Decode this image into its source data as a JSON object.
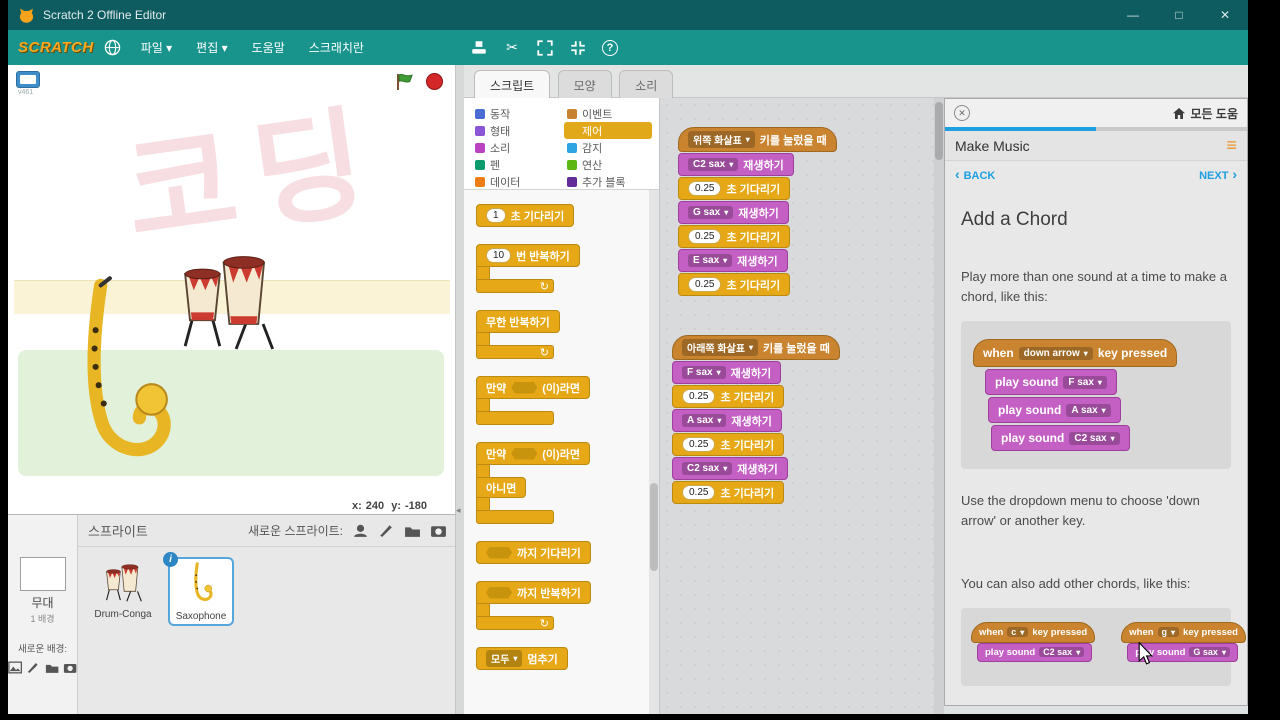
{
  "window": {
    "title": "Scratch 2 Offline Editor",
    "controls": {
      "minimize": "—",
      "maximize": "□",
      "close": "✕"
    }
  },
  "menubar": {
    "logo": "SCRATCH",
    "items": [
      {
        "label": "파일 ▾"
      },
      {
        "label": "편집 ▾"
      },
      {
        "label": "도움말"
      },
      {
        "label": "스크래치란"
      }
    ]
  },
  "stage": {
    "version": "v461",
    "watermark": "코딩",
    "coords": {
      "x_label": "x:",
      "x_value": "240",
      "y_label": "y:",
      "y_value": "-180"
    }
  },
  "sprites_panel": {
    "title": "스프라이트",
    "new_sprite_label": "새로운 스프라이트:",
    "stage_section": {
      "label": "무대",
      "count": "1 배경",
      "new_backdrop_label": "새로운 배경:"
    },
    "items": [
      {
        "name": "Drum-Conga"
      },
      {
        "name": "Saxophone"
      }
    ]
  },
  "script_area": {
    "tabs": [
      {
        "label": "스크립트"
      },
      {
        "label": "모양"
      },
      {
        "label": "소리"
      }
    ],
    "categories": {
      "col1": [
        {
          "label": "동작",
          "color": "#4a6cd4"
        },
        {
          "label": "형태",
          "color": "#8a55d7"
        },
        {
          "label": "소리",
          "color": "#bb42c3"
        },
        {
          "label": "펜",
          "color": "#0e9a6c"
        },
        {
          "label": "데이터",
          "color": "#ee7d16"
        }
      ],
      "col2": [
        {
          "label": "이벤트",
          "color": "#c88330"
        },
        {
          "label": "제어",
          "color": "#e1a91a"
        },
        {
          "label": "감지",
          "color": "#2ca5e2"
        },
        {
          "label": "연산",
          "color": "#5cb712"
        },
        {
          "label": "추가 블록",
          "color": "#632d99"
        }
      ]
    }
  },
  "palette": {
    "loop_glyph": "↻",
    "wait": {
      "num": "1",
      "label": "초 기다리기"
    },
    "repeat": {
      "num": "10",
      "label": "번 반복하기"
    },
    "forever": {
      "label": "무한 반복하기"
    },
    "if_block": {
      "pre": "만약",
      "post": "(이)라면"
    },
    "if_else": {
      "pre": "만약",
      "post": "(이)라면",
      "else_label": "아니면"
    },
    "wait_until": {
      "label": "까지 기다리기"
    },
    "repeat_until": {
      "label": "까지 반복하기"
    },
    "stop": {
      "dd": "모두",
      "label": "멈추기"
    }
  },
  "scripts": [
    {
      "hat_key": "위쪽 화살표",
      "hat_label": "키를 눌렀을 때",
      "rows": [
        {
          "dd": "C2 sax",
          "label": "재생하기"
        },
        {
          "num": "0.25",
          "label": "초 기다리기"
        },
        {
          "dd": "G sax",
          "label": "재생하기"
        },
        {
          "num": "0.25",
          "label": "초 기다리기"
        },
        {
          "dd": "E sax",
          "label": "재생하기"
        },
        {
          "num": "0.25",
          "label": "초 기다리기"
        }
      ]
    },
    {
      "hat_key": "아래쪽 화살표",
      "hat_label": "키를 눌렀을 때",
      "rows": [
        {
          "dd": "F sax",
          "label": "재생하기"
        },
        {
          "num": "0.25",
          "label": "초 기다리기"
        },
        {
          "dd": "A sax",
          "label": "재생하기"
        },
        {
          "num": "0.25",
          "label": "초 기다리기"
        },
        {
          "dd": "C2 sax",
          "label": "재생하기"
        },
        {
          "num": "0.25",
          "label": "초 기다리기"
        }
      ]
    }
  ],
  "tips": {
    "all_tips_label": "모든 도움",
    "section_title": "Make Music",
    "back_label": "BACK",
    "next_label": "NEXT",
    "heading": "Add a Chord",
    "para1": "Play more than one sound at a time to make a chord, like this:",
    "para2": "Use the dropdown menu to choose 'down arrow' or another key.",
    "para3": "You can also add other chords, like this:",
    "example": {
      "when": "when",
      "key": "down arrow",
      "suffix": "key pressed",
      "play_label": "play sound",
      "sounds": [
        {
          "name": "F sax"
        },
        {
          "name": "A sax"
        },
        {
          "name": "C2 sax"
        }
      ]
    },
    "minis": [
      {
        "when": "when",
        "key": "c",
        "suffix": "key pressed",
        "play_label": "play sound",
        "sound": "C2 sax"
      },
      {
        "when": "when",
        "key": "g",
        "suffix": "key pressed",
        "play_label": "play sound",
        "sound": "G sax"
      }
    ]
  }
}
